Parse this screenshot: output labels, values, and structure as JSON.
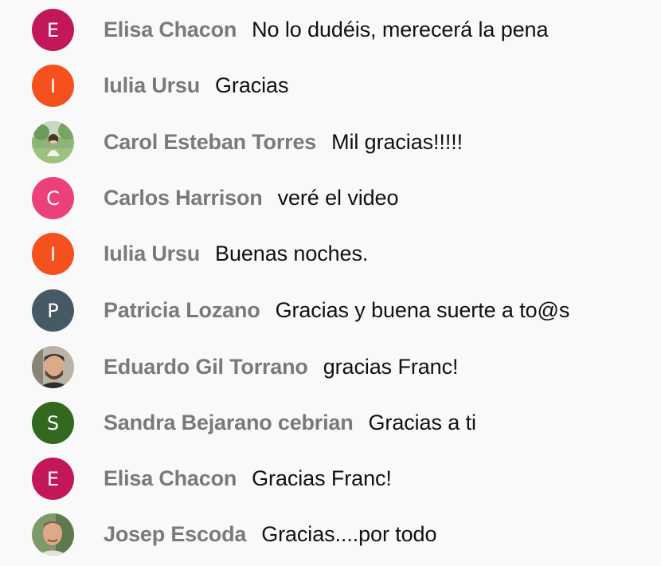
{
  "messages": [
    {
      "author": "Elisa Chacon",
      "text": "No lo dudéis, merecerá la pena",
      "avatar": {
        "type": "initial",
        "initial": "E",
        "color": "#c2185b"
      }
    },
    {
      "author": "Iulia Ursu",
      "text": "Gracias",
      "avatar": {
        "type": "initial",
        "initial": "I",
        "color": "#f4511e"
      }
    },
    {
      "author": "Carol Esteban Torres",
      "text": "Mil gracias!!!!!",
      "avatar": {
        "type": "photo",
        "icon": "user-photo-outdoor"
      }
    },
    {
      "author": "Carlos Harrison",
      "text": "veré el video",
      "avatar": {
        "type": "initial",
        "initial": "C",
        "color": "#ec407a"
      }
    },
    {
      "author": "Iulia Ursu",
      "text": "Buenas noches.",
      "avatar": {
        "type": "initial",
        "initial": "I",
        "color": "#f4511e"
      }
    },
    {
      "author": "Patricia Lozano",
      "text": "Gracias y buena suerte a to@s",
      "avatar": {
        "type": "initial",
        "initial": "P",
        "color": "#455a64"
      }
    },
    {
      "author": "Eduardo Gil Torrano",
      "text": "gracias Franc!",
      "avatar": {
        "type": "photo",
        "icon": "user-photo-man"
      }
    },
    {
      "author": "Sandra Bejarano cebrian",
      "text": "Gracias a ti",
      "avatar": {
        "type": "initial",
        "initial": "S",
        "color": "#33691e"
      }
    },
    {
      "author": "Elisa Chacon",
      "text": "Gracias Franc!",
      "avatar": {
        "type": "initial",
        "initial": "E",
        "color": "#c2185b"
      }
    },
    {
      "author": "Josep Escoda",
      "text": "Gracias....por todo",
      "avatar": {
        "type": "photo",
        "icon": "user-photo-man-older"
      }
    }
  ]
}
